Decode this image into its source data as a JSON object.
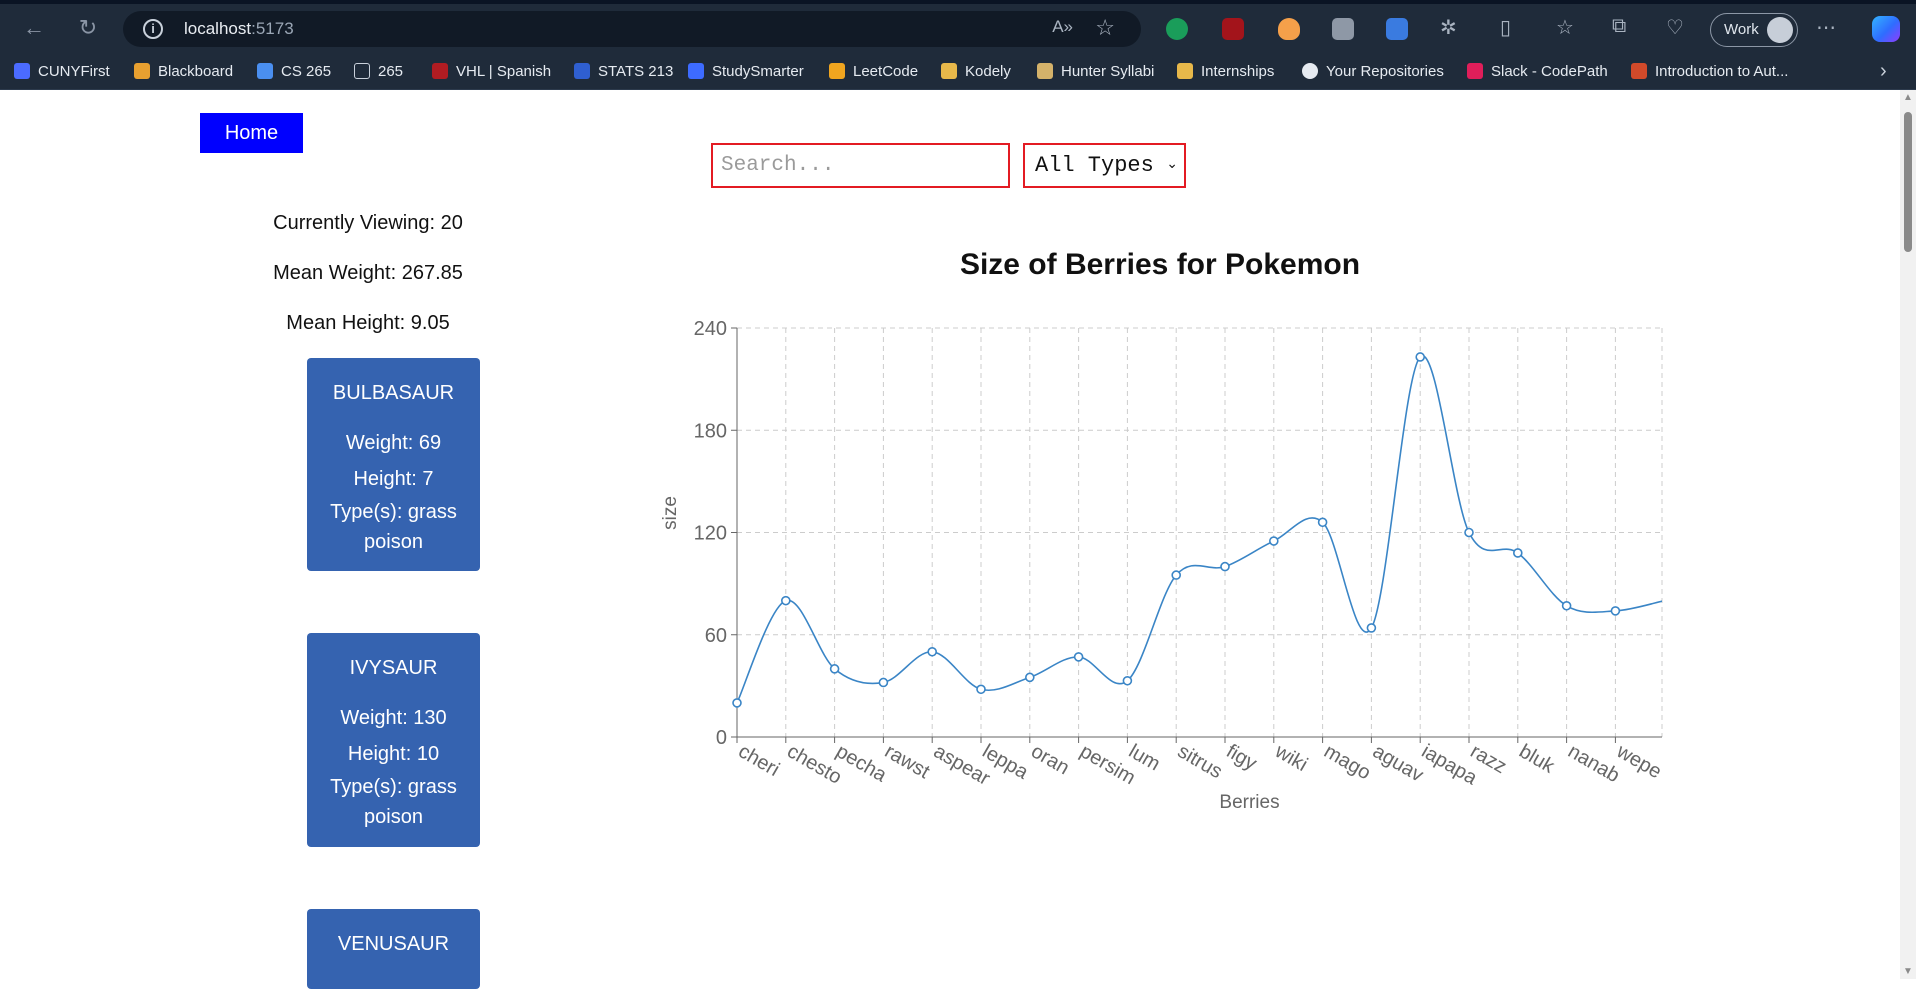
{
  "browser": {
    "url_host": "localhost",
    "url_port": ":5173",
    "profile_label": "Work",
    "bookmarks": [
      {
        "label": "CUNYFirst",
        "color": "#4b6bff"
      },
      {
        "label": "Blackboard",
        "color": "#e8a030"
      },
      {
        "label": "CS 265",
        "color": "#4a8ff0"
      },
      {
        "label": "265",
        "color": "#c9d1db"
      },
      {
        "label": "VHL | Spanish",
        "color": "#b01c22"
      },
      {
        "label": "STATS 213",
        "color": "#2f5fd0"
      },
      {
        "label": "StudySmarter",
        "color": "#3d6bff"
      },
      {
        "label": "LeetCode",
        "color": "#f0a51f"
      },
      {
        "label": "Kodely",
        "color": "#e7b84a"
      },
      {
        "label": "Hunter Syllabi",
        "color": "#d4b26a"
      },
      {
        "label": "Internships",
        "color": "#e7b84a"
      },
      {
        "label": "Your Repositories",
        "color": "#e6ebf1"
      },
      {
        "label": "Slack - CodePath",
        "color": "#e01e5a"
      },
      {
        "label": "Introduction to Aut...",
        "color": "#d24a2a"
      }
    ]
  },
  "nav": {
    "home_label": "Home"
  },
  "filters": {
    "search_placeholder": "Search...",
    "type_selected": "All Types"
  },
  "stats": {
    "viewing": "Currently Viewing: 20",
    "mean_weight": "Mean Weight: 267.85",
    "mean_height": "Mean Height: 9.05"
  },
  "pokemon": [
    {
      "name": "BULBASAUR",
      "weight": "Weight: 69",
      "height": "Height: 7",
      "types": "Type(s): grass poison"
    },
    {
      "name": "IVYSAUR",
      "weight": "Weight: 130",
      "height": "Height: 10",
      "types": "Type(s): grass poison"
    },
    {
      "name": "VENUSAUR"
    }
  ],
  "chart_data": {
    "type": "line",
    "title": "Size of Berries for Pokemon",
    "xlabel": "Berries",
    "ylabel": "size",
    "ylim": [
      0,
      240
    ],
    "yticks": [
      0,
      60,
      120,
      180,
      240
    ],
    "grid": true,
    "line_color": "#3a85c6",
    "categories": [
      "cheri",
      "chesto",
      "pecha",
      "rawst",
      "aspear",
      "leppa",
      "oran",
      "persim",
      "lum",
      "sitrus",
      "figy",
      "wiki",
      "mago",
      "aguav",
      "iapapa",
      "razz",
      "bluk",
      "nanab",
      "wepear"
    ],
    "values": [
      20,
      80,
      40,
      32,
      50,
      28,
      35,
      47,
      33,
      95,
      100,
      115,
      126,
      64,
      223,
      120,
      108,
      77,
      74,
      80
    ]
  }
}
